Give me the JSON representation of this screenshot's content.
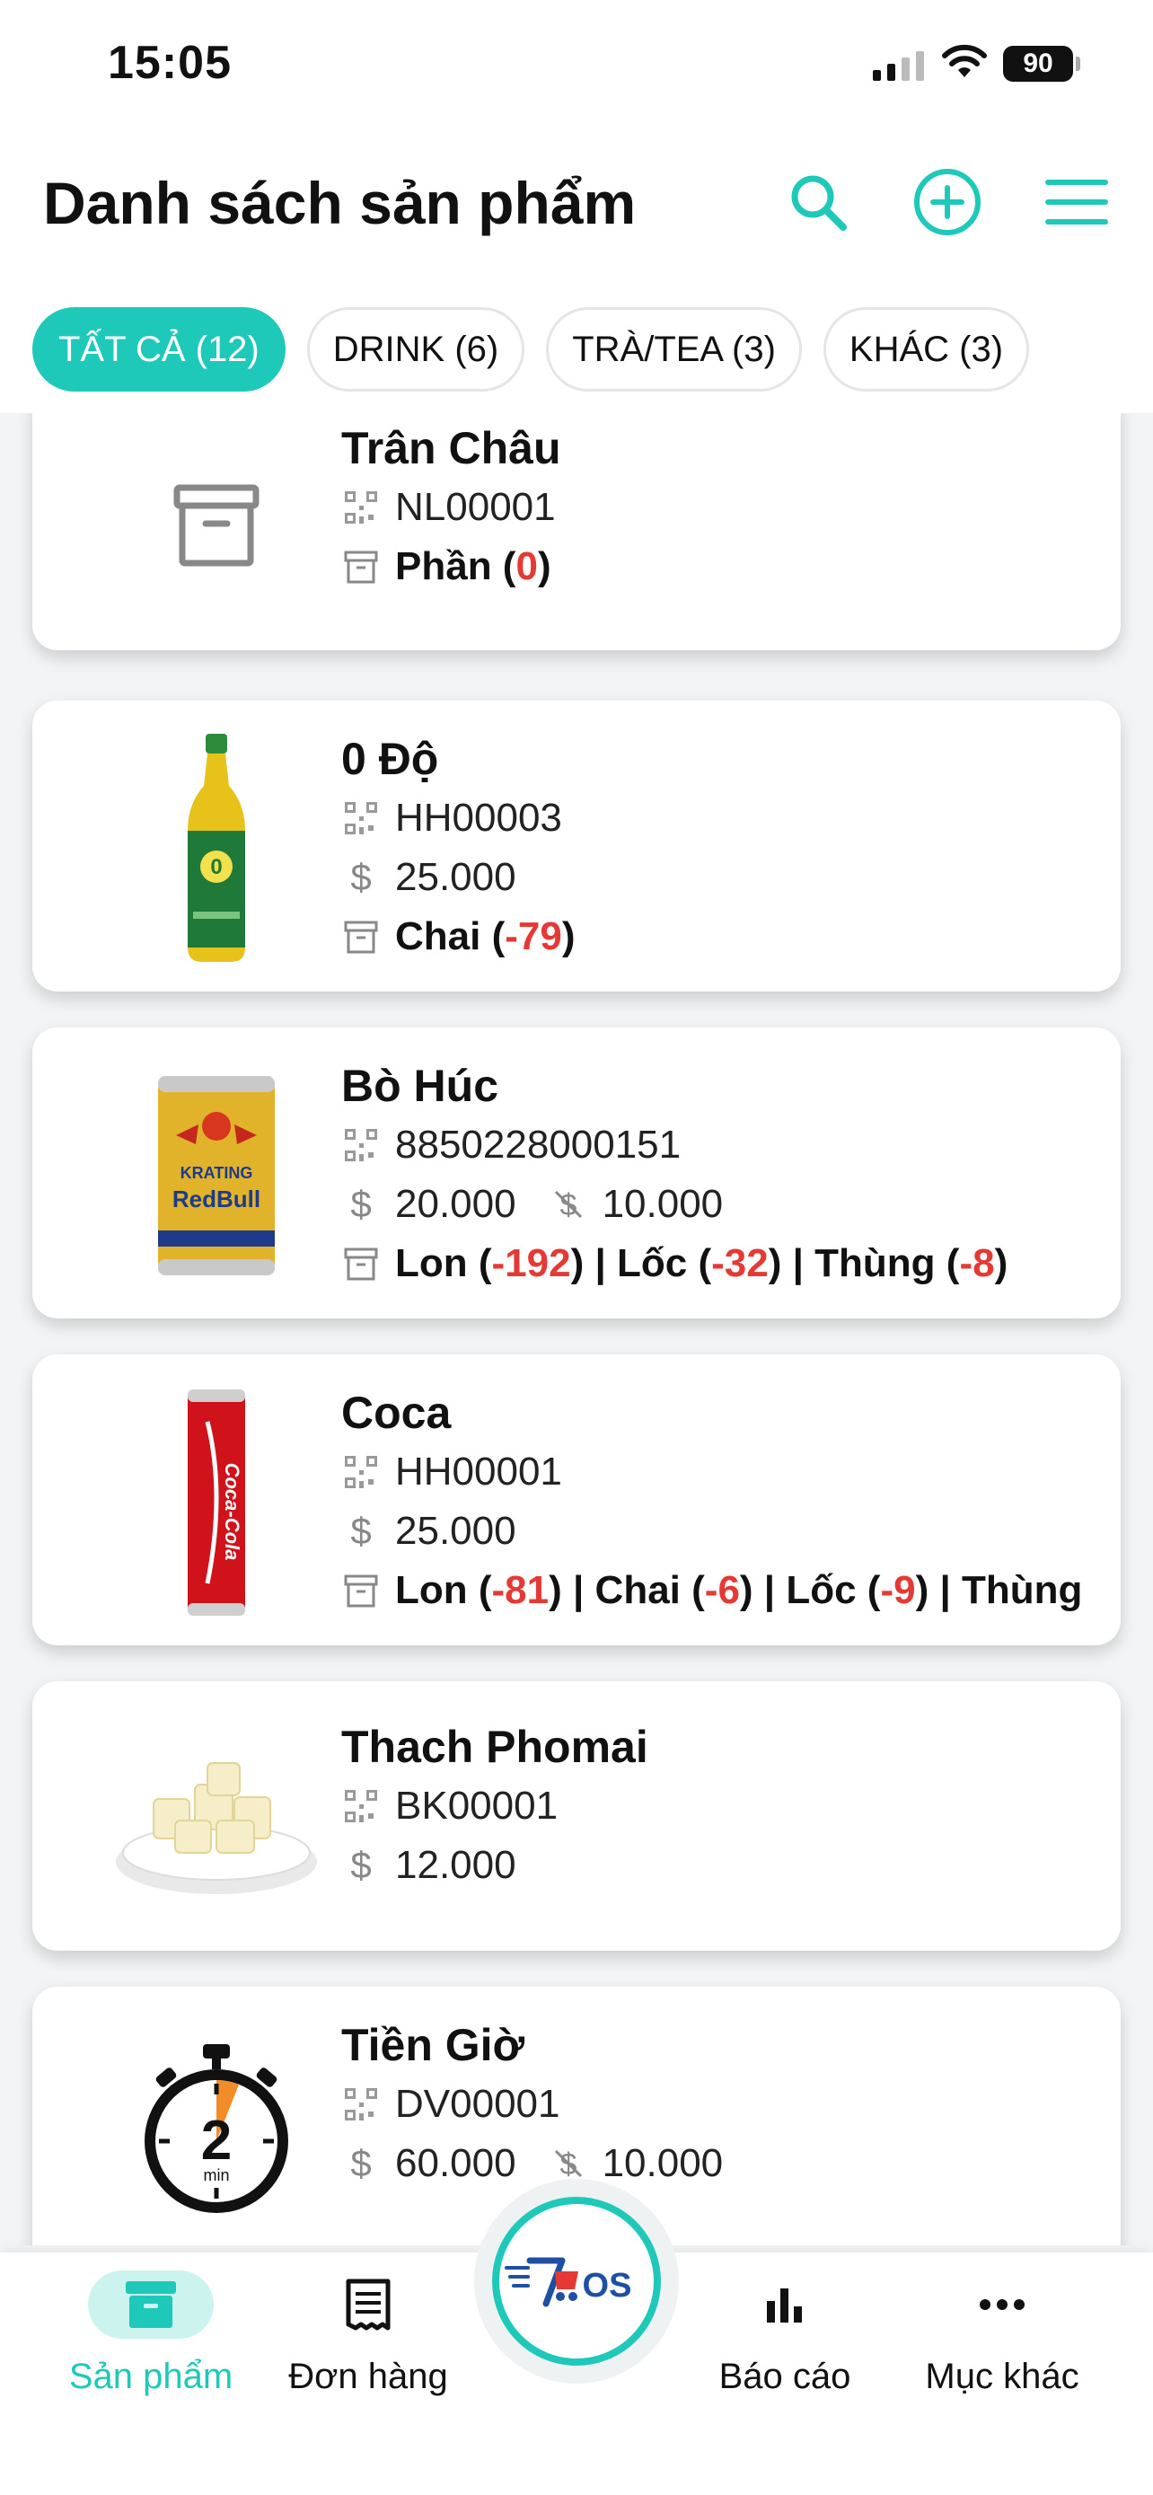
{
  "status": {
    "time": "15:05",
    "battery": "90"
  },
  "header": {
    "title": "Danh sách sản phẩm"
  },
  "tabs": [
    {
      "label": "TẤT CẢ (12)"
    },
    {
      "label": "DRINK (6)"
    },
    {
      "label": "TRÀ/TEA (3)"
    },
    {
      "label": "KHÁC (3)"
    }
  ],
  "products": [
    {
      "name": "Trân Châu",
      "code": "NL00001",
      "unit": "Phần",
      "stock": "0"
    },
    {
      "name": "0 Độ",
      "code": "HH00003",
      "price": "25.000",
      "unit": "Chai",
      "stock": "-79"
    },
    {
      "name": "Bò Húc",
      "code": "8850228000151",
      "price": "20.000",
      "discount": "10.000",
      "units": [
        {
          "unit": "Lon",
          "stock": "-192"
        },
        {
          "unit": "Lốc",
          "stock": "-32"
        },
        {
          "unit": "Thùng",
          "stock": "-8"
        }
      ],
      "sep": " | "
    },
    {
      "name": "Coca",
      "code": "HH00001",
      "price": "25.000",
      "units": [
        {
          "unit": "Lon",
          "stock": "-81"
        },
        {
          "unit": "Chai",
          "stock": "-6"
        },
        {
          "unit": "Lốc",
          "stock": "-9"
        },
        {
          "unit": "Thùng",
          "stock": ""
        }
      ]
    },
    {
      "name": "Thach Phomai",
      "code": "BK00001",
      "price": "12.000"
    },
    {
      "name": "Tiền Giờ",
      "code": "DV00001",
      "price": "60.000",
      "discount": "10.000",
      "timer_digit": "2",
      "timer_unit": "min"
    }
  ],
  "bottom_nav": [
    {
      "label": "Sản phẩm"
    },
    {
      "label": "Đơn hàng"
    },
    {
      "label": "Báo cáo"
    },
    {
      "label": "Mục khác"
    }
  ],
  "fab": {
    "logo_text": "OS"
  },
  "colors": {
    "accent": "#1ec9b9",
    "negative": "#e53935",
    "text": "#111111"
  }
}
